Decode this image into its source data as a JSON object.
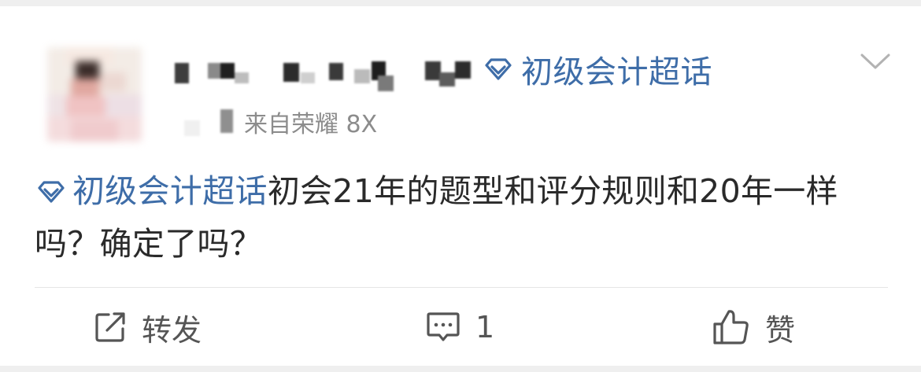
{
  "header": {
    "topic_label": "初级会计超话",
    "topic_icon": "diamond-topic-icon",
    "source_text": "来自荣耀 8X",
    "more_icon": "chevron-down-icon"
  },
  "post": {
    "topic_link": "初级会计超话",
    "text": "初会21年的题型和评分规则和20年一样吗？确定了吗？"
  },
  "actions": {
    "repost_label": "转发",
    "comment_count": "1",
    "like_label": "赞"
  },
  "colors": {
    "topic_blue": "#3e6da8",
    "text": "#2a2a2a",
    "meta_gray": "#8c8c8c",
    "divider": "#e6e6e6"
  }
}
